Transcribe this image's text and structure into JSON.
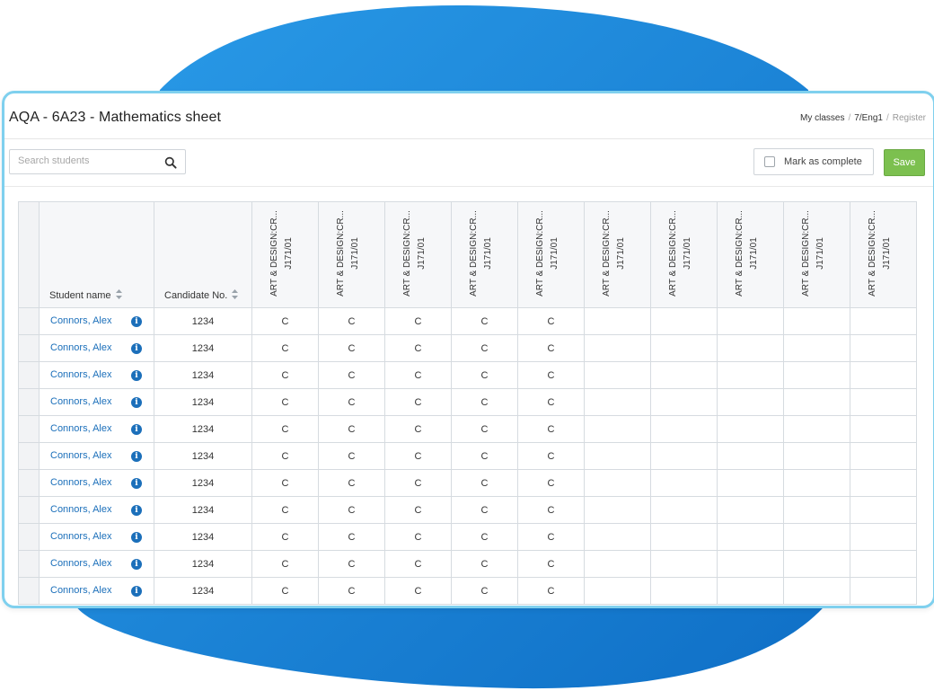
{
  "page": {
    "title": "AQA - 6A23 - Mathematics sheet",
    "breadcrumb": [
      "My classes",
      "7/Eng1",
      "Register"
    ]
  },
  "toolbar": {
    "search_placeholder": "Search students",
    "search_icon": "search-icon",
    "mark_complete_label": "Mark as complete",
    "mark_complete_checked": false,
    "save_label": "Save"
  },
  "colors": {
    "link": "#1b6fba",
    "save_button": "#7cc04f",
    "window_border": "#7fd0ee",
    "background_blob": "#1a86da"
  },
  "table": {
    "columns": {
      "student_name": "Student name",
      "candidate_no": "Candidate No.",
      "assessments": [
        {
          "line1": "ART & DESIGN:CR...",
          "line2": "J171/01"
        },
        {
          "line1": "ART & DESIGN:CR...",
          "line2": "J171/01"
        },
        {
          "line1": "ART & DESIGN:CR...",
          "line2": "J171/01"
        },
        {
          "line1": "ART & DESIGN:CR...",
          "line2": "J171/01"
        },
        {
          "line1": "ART & DESIGN:CR...",
          "line2": "J171/01"
        },
        {
          "line1": "ART & DESIGN:CR...",
          "line2": "J171/01"
        },
        {
          "line1": "ART & DESIGN:CR...",
          "line2": "J171/01"
        },
        {
          "line1": "ART & DESIGN:CR...",
          "line2": "J171/01"
        },
        {
          "line1": "ART & DESIGN:CR...",
          "line2": "J171/01"
        },
        {
          "line1": "ART & DESIGN:CR...",
          "line2": "J171/01"
        }
      ]
    },
    "rows": [
      {
        "name": "Connors, Alex",
        "candidate": "1234",
        "grades": [
          "C",
          "C",
          "C",
          "C",
          "C",
          "",
          "",
          "",
          "",
          ""
        ]
      },
      {
        "name": "Connors, Alex",
        "candidate": "1234",
        "grades": [
          "C",
          "C",
          "C",
          "C",
          "C",
          "",
          "",
          "",
          "",
          ""
        ]
      },
      {
        "name": "Connors, Alex",
        "candidate": "1234",
        "grades": [
          "C",
          "C",
          "C",
          "C",
          "C",
          "",
          "",
          "",
          "",
          ""
        ]
      },
      {
        "name": "Connors, Alex",
        "candidate": "1234",
        "grades": [
          "C",
          "C",
          "C",
          "C",
          "C",
          "",
          "",
          "",
          "",
          ""
        ]
      },
      {
        "name": "Connors, Alex",
        "candidate": "1234",
        "grades": [
          "C",
          "C",
          "C",
          "C",
          "C",
          "",
          "",
          "",
          "",
          ""
        ]
      },
      {
        "name": "Connors, Alex",
        "candidate": "1234",
        "grades": [
          "C",
          "C",
          "C",
          "C",
          "C",
          "",
          "",
          "",
          "",
          ""
        ]
      },
      {
        "name": "Connors, Alex",
        "candidate": "1234",
        "grades": [
          "C",
          "C",
          "C",
          "C",
          "C",
          "",
          "",
          "",
          "",
          ""
        ]
      },
      {
        "name": "Connors, Alex",
        "candidate": "1234",
        "grades": [
          "C",
          "C",
          "C",
          "C",
          "C",
          "",
          "",
          "",
          "",
          ""
        ]
      },
      {
        "name": "Connors, Alex",
        "candidate": "1234",
        "grades": [
          "C",
          "C",
          "C",
          "C",
          "C",
          "",
          "",
          "",
          "",
          ""
        ]
      },
      {
        "name": "Connors, Alex",
        "candidate": "1234",
        "grades": [
          "C",
          "C",
          "C",
          "C",
          "C",
          "",
          "",
          "",
          "",
          ""
        ]
      },
      {
        "name": "Connors, Alex",
        "candidate": "1234",
        "grades": [
          "C",
          "C",
          "C",
          "C",
          "C",
          "",
          "",
          "",
          "",
          ""
        ]
      }
    ]
  }
}
